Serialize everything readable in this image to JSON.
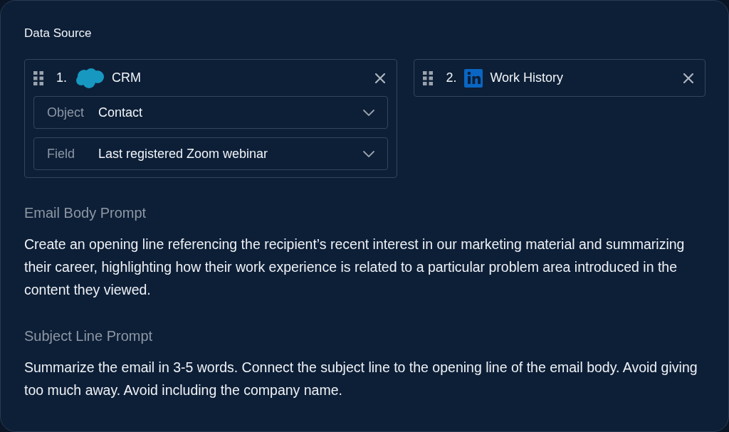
{
  "data_source": {
    "title": "Data Source",
    "sources": [
      {
        "number": "1.",
        "kind": "cloud",
        "name": "CRM",
        "fields": [
          {
            "label": "Object",
            "value": "Contact"
          },
          {
            "label": "Field",
            "value": "Last registered Zoom webinar"
          }
        ]
      },
      {
        "number": "2.",
        "kind": "linkedin",
        "name": "Work History"
      }
    ]
  },
  "prompts": [
    {
      "title": "Email Body Prompt",
      "text": "Create an opening line referencing the recipient’s recent interest in our marketing material and summarizing their career, highlighting how their work experience is related to a particular problem area introduced in the content they viewed."
    },
    {
      "title": "Subject Line Prompt",
      "text": "Summarize the email in 3-5 words. Connect the subject line to the opening line of the email body. Avoid giving too much away. Avoid including the company name."
    }
  ]
}
